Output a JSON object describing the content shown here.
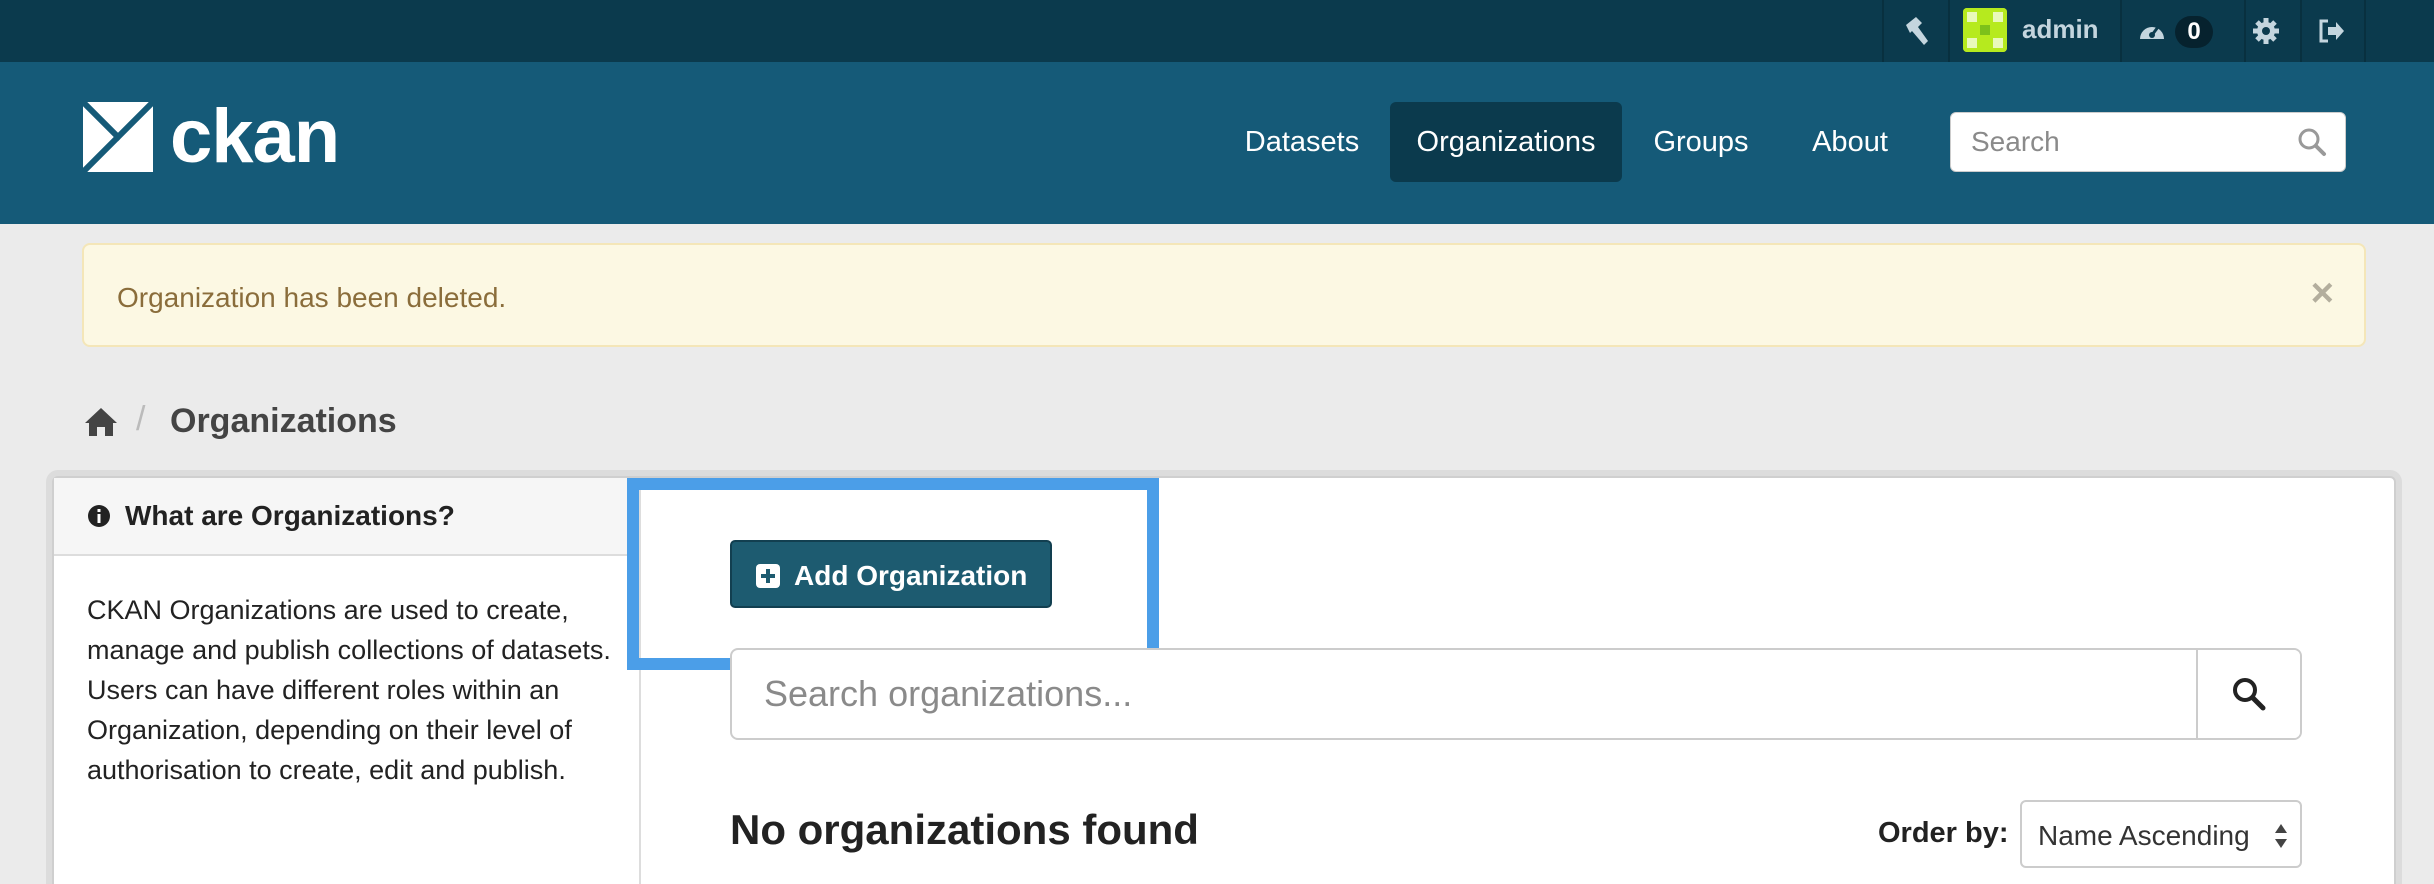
{
  "account": {
    "username": "admin",
    "dashboard_count": "0"
  },
  "masthead": {
    "site_name": "ckan",
    "nav": [
      {
        "label": "Datasets"
      },
      {
        "label": "Organizations"
      },
      {
        "label": "Groups"
      },
      {
        "label": "About"
      }
    ],
    "search_placeholder": "Search"
  },
  "alert": {
    "message": "Organization has been deleted.",
    "close_label": "×"
  },
  "breadcrumb": {
    "separator": "/",
    "current": "Organizations"
  },
  "sidebar": {
    "heading": "What are Organizations?",
    "body": "CKAN Organizations are used to create, manage and publish collections of datasets. Users can have different roles within an Organization, depending on their level of authorisation to create, edit and publish."
  },
  "main": {
    "add_button_label": "Add Organization",
    "search_placeholder": "Search organizations...",
    "no_results": "No organizations found",
    "order_by_label": "Order by:",
    "order_by_value": "Name Ascending"
  },
  "colors": {
    "account_bar": "#0b3a4d",
    "masthead": "#155a78",
    "primary_button": "#1d5b70",
    "highlight": "#4b9ee8",
    "alert_bg": "#fcf8e3"
  }
}
